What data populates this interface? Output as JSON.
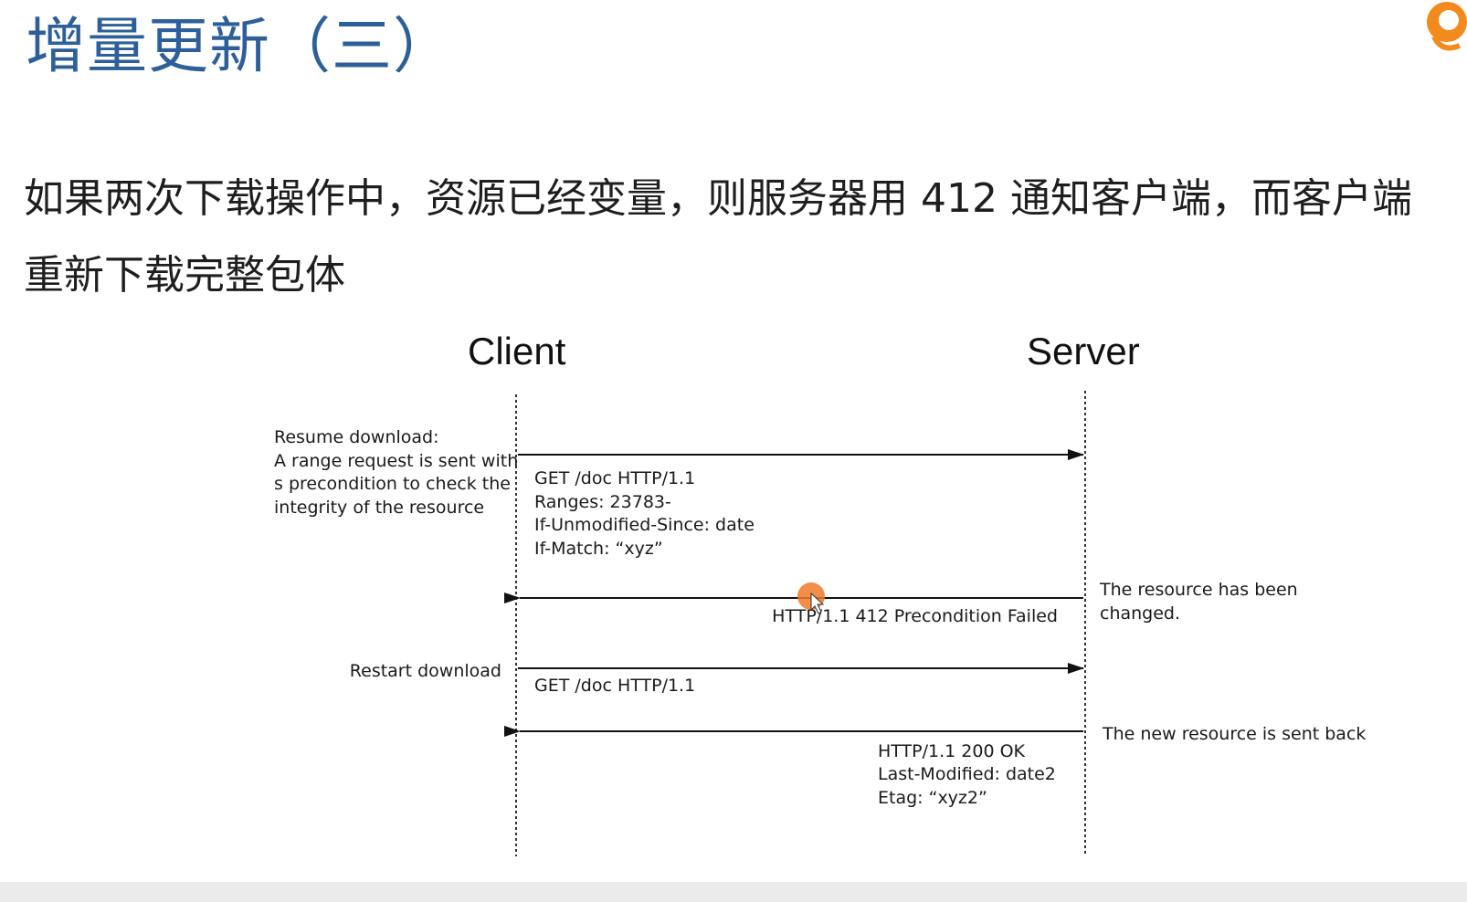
{
  "slide": {
    "title": "增量更新（三）",
    "description": "如果两次下载操作中，资源已经变量，则服务器用 412 通知客户端，而客户端重新下载完整包体",
    "accent_color": "#2d5f9a",
    "logo_color": "#f28a1e"
  },
  "diagram": {
    "lanes": {
      "client": "Client",
      "server": "Server"
    },
    "notes": {
      "resume": [
        "Resume download:",
        "A range request is sent with",
        "s precondition to check the",
        "integrity of the resource"
      ],
      "changed": [
        "The resource has been",
        "changed."
      ],
      "restart": [
        "Restart download"
      ],
      "new_resource": [
        "The new resource is sent back"
      ]
    },
    "messages": [
      {
        "direction": "client-to-server",
        "lines": [
          "GET  /doc HTTP/1.1",
          "Ranges:  23783-",
          "If-Unmodified-Since:  date",
          "If-Match:   “xyz”"
        ]
      },
      {
        "direction": "server-to-client",
        "lines": [
          "HTTP/1.1    412   Precondition  Failed"
        ]
      },
      {
        "direction": "client-to-server",
        "lines": [
          "GET    /doc  HTTP/1.1"
        ]
      },
      {
        "direction": "server-to-client",
        "lines": [
          "HTTP/1.1    200  OK",
          "Last-Modified:  date2",
          "Etag:   “xyz2”"
        ]
      }
    ]
  }
}
